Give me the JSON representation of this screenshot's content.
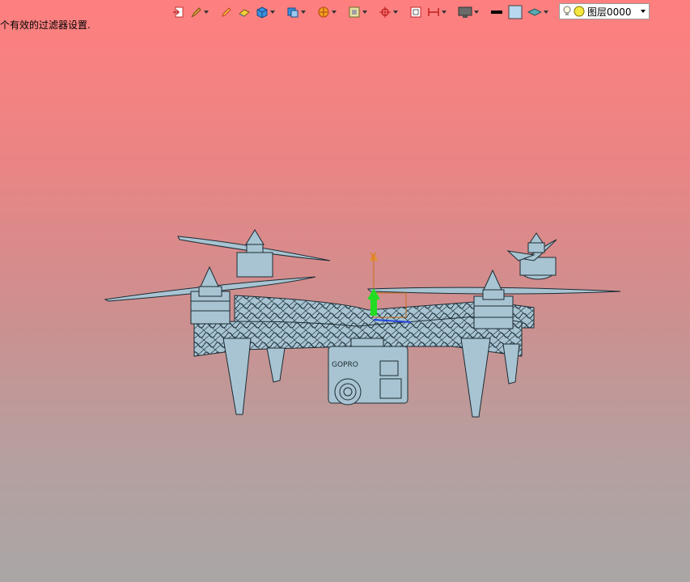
{
  "status": {
    "message": "个有效的过滤器设置."
  },
  "toolbar": {
    "icons": [
      "exit-icon",
      "brush-icon",
      "pencil-icon",
      "eraser-icon",
      "cube-icon",
      "layers-view-icon",
      "render-sphere-icon",
      "box-select-icon",
      "snap-icon",
      "frame-icon",
      "dimension-icon",
      "monitor-icon",
      "line-color-swatch",
      "fill-color-swatch",
      "layer-icon"
    ],
    "line_color": "#000000",
    "fill_color": "#b8d8ef"
  },
  "layer": {
    "selected": "图层0000"
  },
  "viewport": {
    "axis_label": "Y",
    "camera_brand": "GOPRO",
    "background_top": "#ff7f7f",
    "background_bottom": "#aaa6a6",
    "model_color": "#a8c4d2"
  }
}
